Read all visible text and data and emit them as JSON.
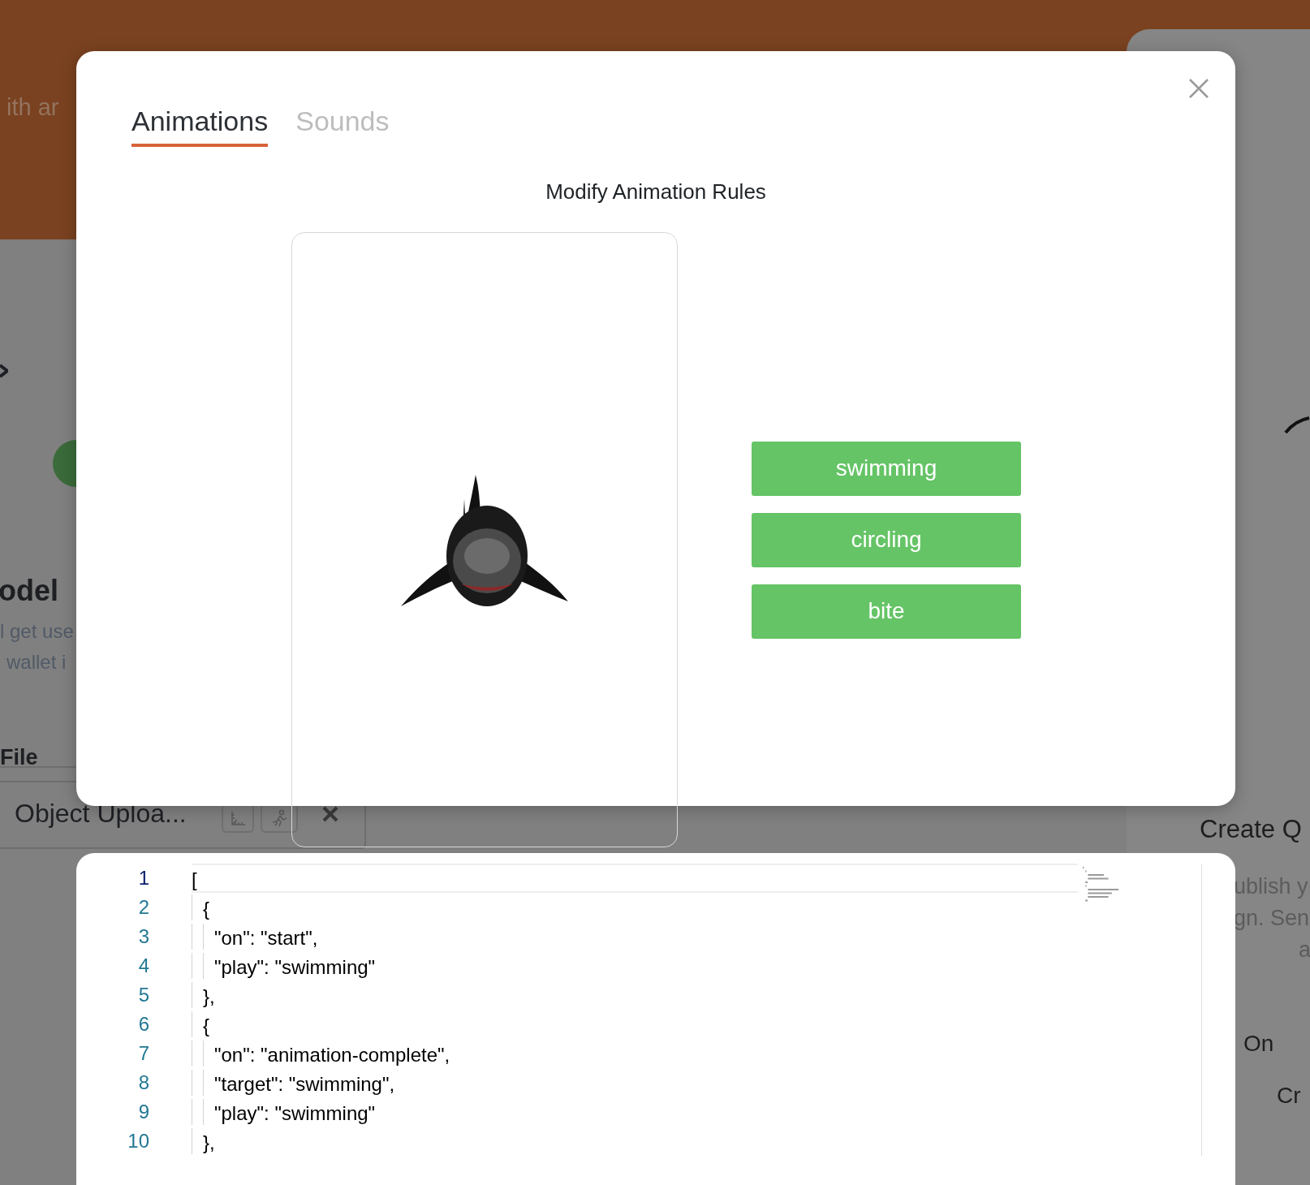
{
  "background_page": {
    "banner_text": "ith ar",
    "section_title": "odel",
    "section_text_lines": [
      "l get use",
      "wallet i"
    ],
    "file_label": "File",
    "file_name": "Object Uploa...",
    "right_panel": {
      "title": "Create Q",
      "text_lines": [
        "ublish y",
        "gn. Sen",
        "a"
      ],
      "option_label": "On",
      "button_label": "Cr"
    }
  },
  "dialog": {
    "tabs": [
      {
        "label": "Animations",
        "selected": true
      },
      {
        "label": "Sounds",
        "selected": false
      }
    ],
    "title": "Modify Animation Rules",
    "animations": [
      {
        "label": "swimming"
      },
      {
        "label": "circling"
      },
      {
        "label": "bite"
      }
    ]
  },
  "code_editor": {
    "lines": [
      {
        "number": "1",
        "text": "[",
        "current": true
      },
      {
        "number": "2",
        "text": "  {",
        "current": false
      },
      {
        "number": "3",
        "text": "    \"on\": \"start\",",
        "current": false
      },
      {
        "number": "4",
        "text": "    \"play\": \"swimming\"",
        "current": false
      },
      {
        "number": "5",
        "text": "  },",
        "current": false
      },
      {
        "number": "6",
        "text": "  {",
        "current": false
      },
      {
        "number": "7",
        "text": "    \"on\": \"animation-complete\",",
        "current": false
      },
      {
        "number": "8",
        "text": "    \"target\": \"swimming\",",
        "current": false
      },
      {
        "number": "9",
        "text": "    \"play\": \"swimming\"",
        "current": false
      },
      {
        "number": "10",
        "text": "  },",
        "current": false
      }
    ]
  }
}
